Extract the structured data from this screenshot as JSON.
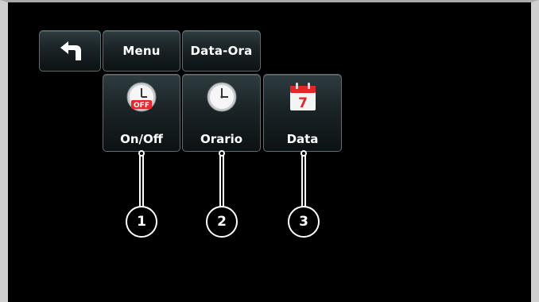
{
  "toolbar": {
    "back_icon": "back-arrow-icon",
    "menu_label": "Menu",
    "breadcrumb_label": "Data-Ora"
  },
  "items": [
    {
      "label": "On/Off",
      "icon": "clock-off-icon",
      "badge": "OFF",
      "callout": "1"
    },
    {
      "label": "Orario",
      "icon": "clock-icon",
      "callout": "2"
    },
    {
      "label": "Data",
      "icon": "calendar-icon",
      "day": "7",
      "callout": "3"
    }
  ],
  "colors": {
    "background": "#000000",
    "tile_border": "#5c6c70",
    "badge_red": "#e8262b",
    "calendar_red": "#e2262a"
  }
}
